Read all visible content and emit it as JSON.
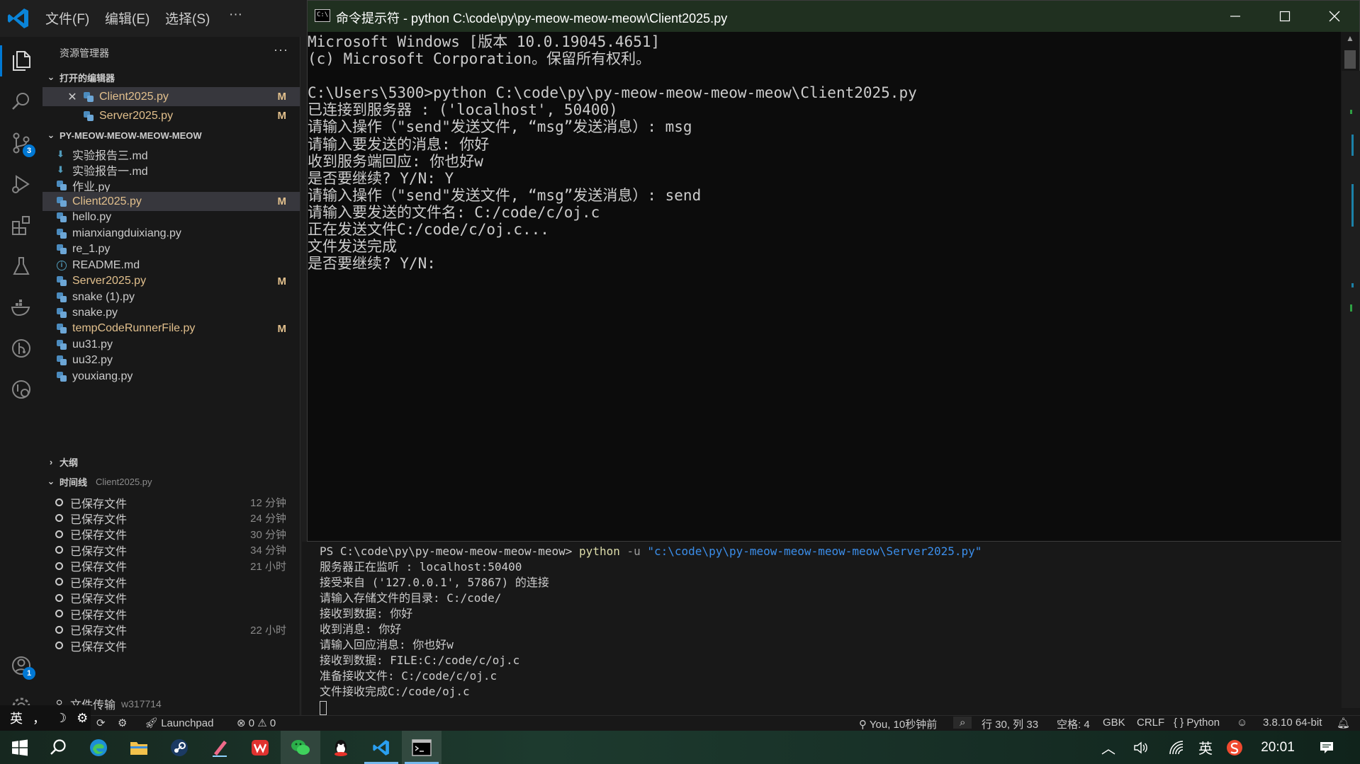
{
  "titlebar": {
    "menus": [
      "文件(F)",
      "编辑(E)",
      "选择(S)",
      "···"
    ]
  },
  "activity": {
    "scm_badge": "3",
    "accounts_badge": "1"
  },
  "explorer": {
    "title": "资源管理器",
    "more": "···",
    "open_editors_label": "打开的编辑器",
    "open_editors": [
      {
        "name": "Client2025.py",
        "flag": "M"
      },
      {
        "name": "Server2025.py",
        "flag": "M"
      }
    ],
    "folder_label": "PY-MEOW-MEOW-MEOW-MEOW",
    "files": [
      {
        "name": "实验报告三.md",
        "flag": ""
      },
      {
        "name": "实验报告一.md",
        "flag": ""
      },
      {
        "name": "作业.py",
        "flag": ""
      },
      {
        "name": "Client2025.py",
        "flag": "M"
      },
      {
        "name": "hello.py",
        "flag": ""
      },
      {
        "name": "mianxiangduixiang.py",
        "flag": ""
      },
      {
        "name": "re_1.py",
        "flag": ""
      },
      {
        "name": "README.md",
        "flag": ""
      },
      {
        "name": "Server2025.py",
        "flag": "M"
      },
      {
        "name": "snake (1).py",
        "flag": ""
      },
      {
        "name": "snake.py",
        "flag": ""
      },
      {
        "name": "tempCodeRunnerFile.py",
        "flag": "M"
      },
      {
        "name": "uu31.py",
        "flag": ""
      },
      {
        "name": "uu32.py",
        "flag": ""
      },
      {
        "name": "youxiang.py",
        "flag": ""
      }
    ],
    "outline_label": "大纲",
    "timeline_label": "时间线",
    "timeline_file": "Client2025.py",
    "timeline": [
      {
        "label": "已保存文件",
        "time": "12 分钟"
      },
      {
        "label": "已保存文件",
        "time": "24 分钟"
      },
      {
        "label": "已保存文件",
        "time": "30 分钟"
      },
      {
        "label": "已保存文件",
        "time": "34 分钟"
      },
      {
        "label": "已保存文件",
        "time": "21 小时"
      },
      {
        "label": "已保存文件",
        "time": ""
      },
      {
        "label": "已保存文件",
        "time": ""
      },
      {
        "label": "已保存文件",
        "time": ""
      },
      {
        "label": "已保存文件",
        "time": "22 小时"
      },
      {
        "label": "已保存文件",
        "time": ""
      }
    ],
    "timeline_commit": {
      "label": "文件传输",
      "sub": "w317714"
    }
  },
  "cmd": {
    "title": "命令提示符 - python  C:\\code\\py\\py-meow-meow-meow\\Client2025.py",
    "lines": [
      "Microsoft Windows [版本 10.0.19045.4651]",
      "(c) Microsoft Corporation。保留所有权利。",
      "",
      "C:\\Users\\5300>python C:\\code\\py\\py-meow-meow-meow-meow\\Client2025.py",
      "已连接到服务器 : ('localhost', 50400)",
      "请输入操作（\"send\"发送文件, “msg”发送消息）: msg",
      "请输入要发送的消息: 你好",
      "收到服务端回应: 你也好w",
      "是否要继续? Y/N: Y",
      "请输入操作（\"send\"发送文件, “msg”发送消息）: send",
      "请输入要发送的文件名: C:/code/c/oj.c",
      "正在发送文件C:/code/c/oj.c...",
      "文件发送完成",
      "是否要继续? Y/N:"
    ]
  },
  "terminal": {
    "prompt": "PS C:\\code\\py\\py-meow-meow-meow-meow> ",
    "cmd": "python",
    "flag": " -u ",
    "arg": "\"c:\\code\\py\\py-meow-meow-meow-meow\\Server2025.py\"",
    "lines": [
      "服务器正在监听 : localhost:50400",
      "接受来自 ('127.0.0.1', 57867) 的连接",
      "请输入存储文件的目录: C:/code/",
      "接收到数据: 你好",
      "收到消息: 你好",
      "请输入回应消息: 你也好w",
      "接收到数据: FILE:C:/code/c/oj.c",
      "准备接收文件: C:/code/c/oj.c",
      "文件接收完成C:/code/oj.c"
    ]
  },
  "statusbar": {
    "ime": "英",
    "ime_punct": "，",
    "launchpad": "Launchpad",
    "errors": "0",
    "warnings": "0",
    "blame": "You, 10秒钟前",
    "position": "行 30, 列 33",
    "spaces": "空格: 4",
    "encoding": "GBK",
    "eol": "CRLF",
    "language": "Python",
    "interpreter": "3.8.10 64-bit"
  },
  "taskbar": {
    "ime": "英",
    "clock": "20:01"
  },
  "colors": {
    "accent": "#0078d4",
    "modified": "#e2c08d",
    "terminal_string": "#3b8eea",
    "terminal_command": "#dcdcaa"
  }
}
